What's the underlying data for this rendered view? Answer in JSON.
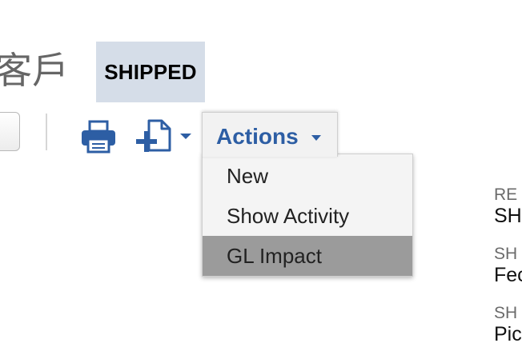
{
  "header": {
    "title_partial": "客戶",
    "status_badge": "SHIPPED"
  },
  "toolbar": {
    "print_icon": "print-icon",
    "export_icon": "export-document-icon",
    "export_caret_icon": "chevron-down-icon",
    "actions_label": "Actions",
    "actions_caret_icon": "chevron-down-icon"
  },
  "actions_menu": {
    "items": [
      {
        "label": "New"
      },
      {
        "label": "Show Activity"
      },
      {
        "label": "GL Impact",
        "highlighted": true
      }
    ]
  },
  "right_fields": [
    {
      "label": "RE",
      "value": "SH"
    },
    {
      "label": "SH",
      "value": "Fec"
    },
    {
      "label": "SH",
      "value": "Pic"
    }
  ],
  "colors": {
    "accent_blue": "#2d5ea4",
    "badge_bg": "#d5dde8",
    "menu_highlight": "#9b9b9b"
  }
}
